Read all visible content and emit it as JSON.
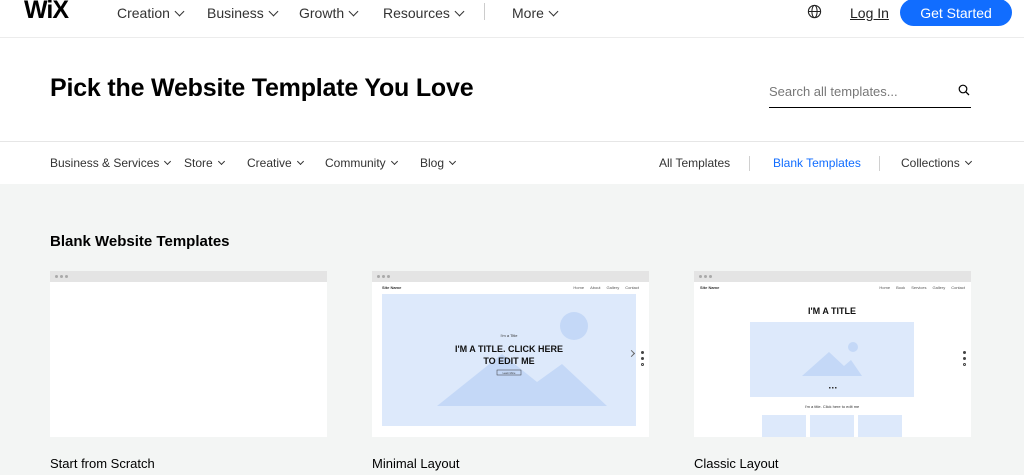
{
  "topnav": {
    "logo": "WiX",
    "items": [
      {
        "label": "Creation"
      },
      {
        "label": "Business"
      },
      {
        "label": "Growth"
      },
      {
        "label": "Resources"
      },
      {
        "label": "More"
      }
    ],
    "login": "Log In",
    "cta": "Get Started"
  },
  "hero": {
    "title": "Pick the Website Template You Love",
    "search_placeholder": "Search all templates..."
  },
  "categories": {
    "left": [
      {
        "label": "Business & Services"
      },
      {
        "label": "Store"
      },
      {
        "label": "Creative"
      },
      {
        "label": "Community"
      },
      {
        "label": "Blog"
      }
    ],
    "all_templates": "All Templates",
    "blank_templates": "Blank Templates",
    "collections": "Collections"
  },
  "section": {
    "title": "Blank Website Templates"
  },
  "templates": [
    {
      "name": "Start from Scratch"
    },
    {
      "name": "Minimal Layout",
      "preview": {
        "site_name": "Site Name",
        "nav_links": [
          "Home",
          "About",
          "Gallery",
          "Contact"
        ],
        "kicker": "I'm a Title",
        "heading_line1": "I'M A TITLE. CLICK HERE",
        "heading_line2": "TO EDIT ME",
        "button": "Learn More"
      }
    },
    {
      "name": "Classic Layout",
      "preview": {
        "site_name": "Site Name",
        "nav_links": [
          "Home",
          "Book",
          "Services",
          "Gallery",
          "Contact"
        ],
        "heading": "I'M A TITLE",
        "paragraph": "I'm a title. Click here to edit me"
      }
    }
  ],
  "colors": {
    "accent": "#116dff",
    "preview_blue": "#dde9fb",
    "preview_shape": "#c4d8f7",
    "page_bg": "#f3f5f4"
  },
  "icons": {
    "globe": "globe-icon",
    "search": "search-icon",
    "chevron": "chevron-down-icon"
  }
}
